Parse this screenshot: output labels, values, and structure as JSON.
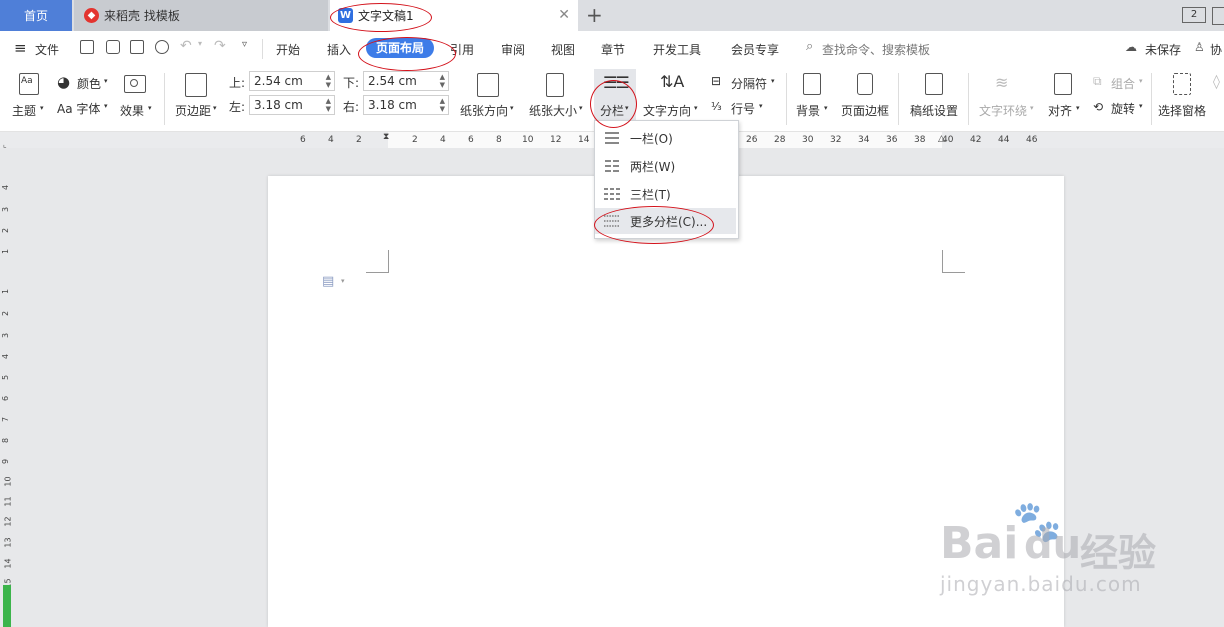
{
  "tabs": {
    "home": "首页",
    "daoke": "来稻壳 找模板",
    "doc": "文字文稿1",
    "add": "+",
    "window_count": "2"
  },
  "menu": {
    "file": "文件",
    "items": [
      "开始",
      "插入",
      "页面布局",
      "引用",
      "审阅",
      "视图",
      "章节",
      "开发工具",
      "会员专享"
    ],
    "search_placeholder": "查找命令、搜索模板",
    "unsaved": "未保存",
    "collab": "协"
  },
  "ribbon": {
    "theme": "主题",
    "color": "颜色",
    "font": "Aa 字体",
    "effect": "效果",
    "margin": "页边距",
    "top_label": "上:",
    "top_value": "2.54 cm",
    "bottom_label": "下:",
    "bottom_value": "2.54 cm",
    "left_label": "左:",
    "left_value": "3.18 cm",
    "right_label": "右:",
    "right_value": "3.18 cm",
    "orientation": "纸张方向",
    "size": "纸张大小",
    "columns": "分栏",
    "text_direction": "文字方向",
    "break": "分隔符",
    "line_number": "行号",
    "background": "背景",
    "page_border": "页面边框",
    "draft_paper": "稿纸设置",
    "text_wrap": "文字环绕",
    "align": "对齐",
    "group": "组合",
    "rotate": "旋转",
    "select_pane": "选择窗格"
  },
  "ruler": {
    "h_ticks": [
      "6",
      "4",
      "2",
      "2",
      "4",
      "6",
      "8",
      "10",
      "12",
      "14",
      "26",
      "28",
      "30",
      "32",
      "34",
      "36",
      "38",
      "40",
      "42",
      "44",
      "46"
    ],
    "v_ticks": [
      "4",
      "3",
      "2",
      "1",
      "1",
      "2",
      "3",
      "4",
      "5",
      "6",
      "7",
      "8",
      "9",
      "10",
      "11",
      "12",
      "13",
      "14",
      "15"
    ]
  },
  "dropdown": {
    "one": "一栏(O)",
    "two": "两栏(W)",
    "three": "三栏(T)",
    "more": "更多分栏(C)..."
  },
  "watermark": {
    "brand": "Bai",
    "brand2": "du",
    "cn": "经验",
    "url": "jingyan.baidu.com"
  },
  "colors": {
    "accent": "#3d7ce8",
    "annotation": "#d3121b",
    "home_tab": "#4f7fd8"
  }
}
